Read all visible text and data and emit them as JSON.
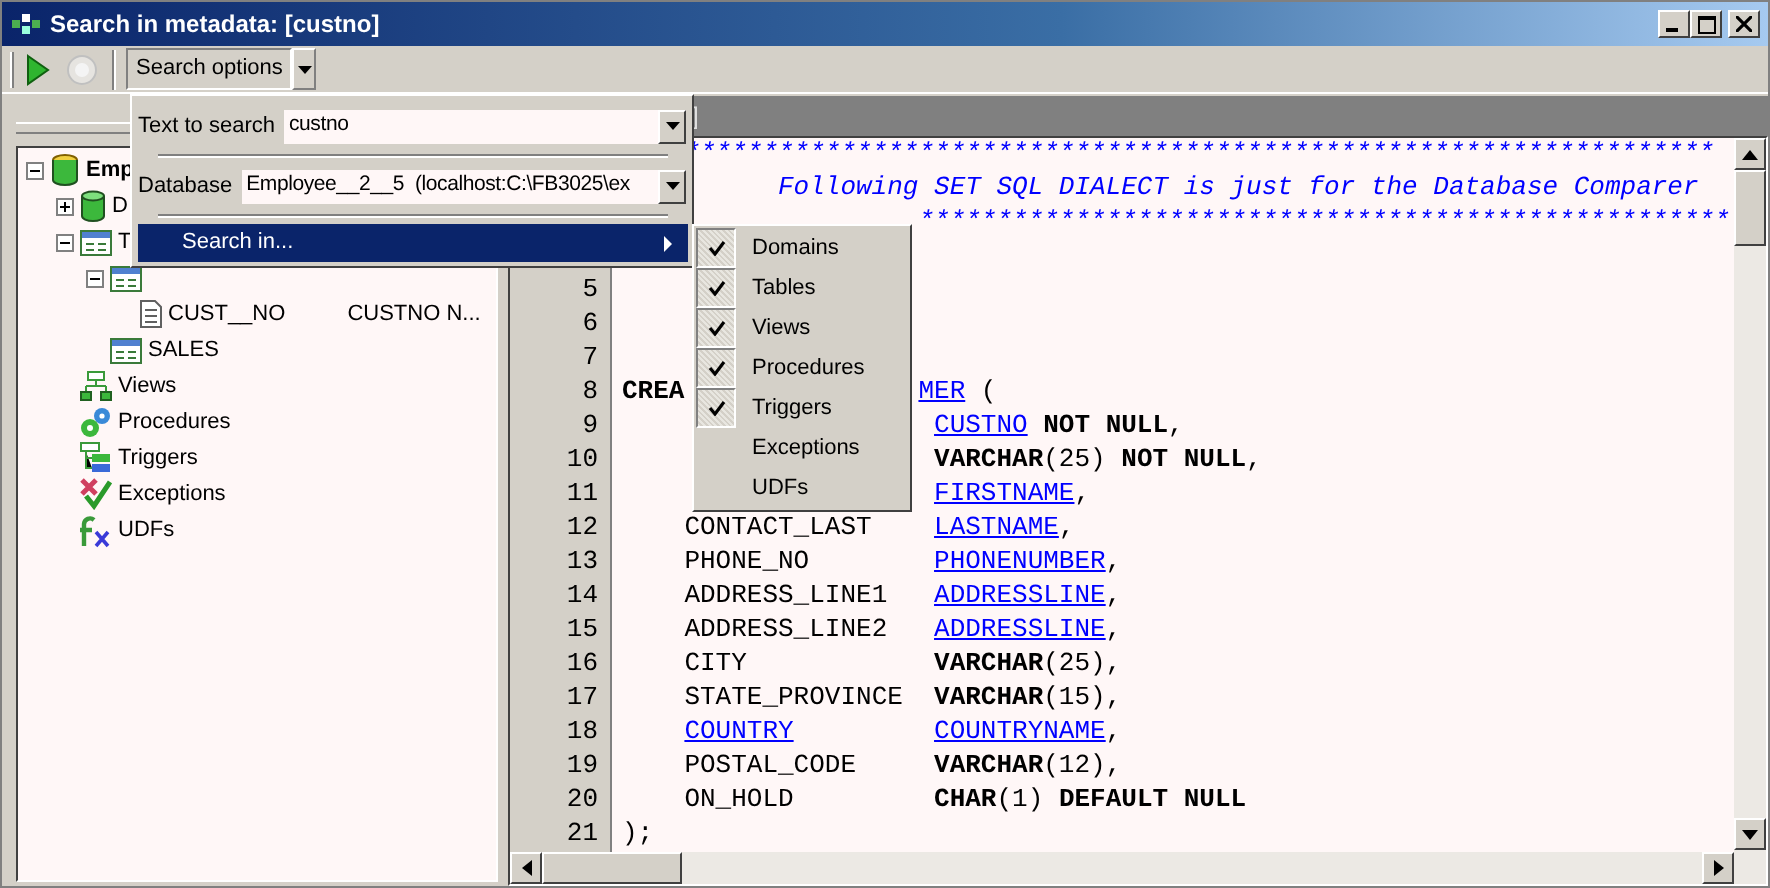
{
  "window": {
    "title": "Search in metadata: [custno]"
  },
  "toolbar": [
    {
      "kind": "run",
      "disabled": false
    },
    {
      "kind": "stop",
      "disabled": true
    }
  ],
  "search_options": {
    "label": "Search options",
    "pressed": true
  },
  "tree": [
    {
      "kind": "database",
      "label": "Emp",
      "expanded": true,
      "children": [
        {
          "kind": "domains",
          "label": "D",
          "expanded": false
        },
        {
          "kind": "tables",
          "label": "T",
          "expanded": true,
          "children": [
            {
              "kind": "table",
              "expanded": true,
              "children": [
                {
                  "kind": "field",
                  "label": "CUST__NO",
                  "detail": "CUSTNO N..."
                }
              ]
            },
            {
              "kind": "table",
              "label": "SALES"
            }
          ]
        },
        {
          "kind": "views",
          "label": "Views"
        },
        {
          "kind": "procedures",
          "label": "Procedures"
        },
        {
          "kind": "triggers",
          "label": "Triggers"
        },
        {
          "kind": "exceptions",
          "label": "Exceptions"
        },
        {
          "kind": "udfs",
          "label": "UDFs"
        }
      ]
    }
  ],
  "editor": {
    "tab": "]",
    "lines": [
      {
        "kind": "banner",
        "segs": [
          {
            "kind": "comment",
            "t": "******************************************************************"
          }
        ]
      },
      {
        "kind": "note",
        "segs": [
          {
            "kind": "comment",
            "t": "Following SET SQL DIALECT is just for the Database Comparer"
          }
        ]
      },
      {
        "kind": "banner_tail",
        "segs": [
          {
            "kind": "comment",
            "t": "****************************************************"
          }
        ]
      },
      {
        "kind": "blank"
      },
      {
        "kind": "blank",
        "no": "5"
      },
      {
        "kind": "blank",
        "no": "6"
      },
      {
        "kind": "blank",
        "no": "7"
      },
      {
        "kind": "stmt",
        "no": "8",
        "name": [
          {
            "kind": "kw",
            "t": "CREA"
          }
        ],
        "type": [
          {
            "kind": "link",
            "t": "MER"
          },
          {
            "kind": "plain",
            "t": " ("
          }
        ]
      },
      {
        "kind": "field",
        "no": "9",
        "type": [
          {
            "kind": "link",
            "t": "CUSTNO"
          },
          {
            "kind": "kw",
            "t": " NOT NULL"
          },
          {
            "kind": "plain",
            "t": ","
          }
        ]
      },
      {
        "kind": "field",
        "no": "10",
        "type": [
          {
            "kind": "kw",
            "t": "VARCHAR"
          },
          {
            "kind": "plain",
            "t": "(25) "
          },
          {
            "kind": "kw",
            "t": "NOT NULL"
          },
          {
            "kind": "plain",
            "t": ","
          }
        ]
      },
      {
        "kind": "field",
        "no": "11",
        "type": [
          {
            "kind": "link",
            "t": "FIRSTNAME"
          },
          {
            "kind": "plain",
            "t": ","
          }
        ]
      },
      {
        "kind": "field",
        "no": "12",
        "name": [
          {
            "kind": "plain",
            "t": "CONTACT_LAST"
          }
        ],
        "type": [
          {
            "kind": "link",
            "t": "LASTNAME"
          },
          {
            "kind": "plain",
            "t": ","
          }
        ]
      },
      {
        "kind": "field",
        "no": "13",
        "name": [
          {
            "kind": "plain",
            "t": "PHONE_NO"
          }
        ],
        "type": [
          {
            "kind": "link",
            "t": "PHONENUMBER"
          },
          {
            "kind": "plain",
            "t": ","
          }
        ]
      },
      {
        "kind": "field",
        "no": "14",
        "name": [
          {
            "kind": "plain",
            "t": "ADDRESS_LINE1"
          }
        ],
        "type": [
          {
            "kind": "link",
            "t": "ADDRESSLINE"
          },
          {
            "kind": "plain",
            "t": ","
          }
        ]
      },
      {
        "kind": "field",
        "no": "15",
        "name": [
          {
            "kind": "plain",
            "t": "ADDRESS_LINE2"
          }
        ],
        "type": [
          {
            "kind": "link",
            "t": "ADDRESSLINE"
          },
          {
            "kind": "plain",
            "t": ","
          }
        ]
      },
      {
        "kind": "field",
        "no": "16",
        "name": [
          {
            "kind": "plain",
            "t": "CITY"
          }
        ],
        "type": [
          {
            "kind": "kw",
            "t": "VARCHAR"
          },
          {
            "kind": "plain",
            "t": "(25),"
          }
        ]
      },
      {
        "kind": "field",
        "no": "17",
        "name": [
          {
            "kind": "plain",
            "t": "STATE_PROVINCE"
          }
        ],
        "type": [
          {
            "kind": "kw",
            "t": "VARCHAR"
          },
          {
            "kind": "plain",
            "t": "(15),"
          }
        ]
      },
      {
        "kind": "field",
        "no": "18",
        "name": [
          {
            "kind": "link",
            "t": "COUNTRY"
          }
        ],
        "type": [
          {
            "kind": "link",
            "t": "COUNTRYNAME"
          },
          {
            "kind": "plain",
            "t": ","
          }
        ]
      },
      {
        "kind": "field",
        "no": "19",
        "name": [
          {
            "kind": "plain",
            "t": "POSTAL_CODE"
          }
        ],
        "type": [
          {
            "kind": "kw",
            "t": "VARCHAR"
          },
          {
            "kind": "plain",
            "t": "(12),"
          }
        ]
      },
      {
        "kind": "field",
        "no": "20",
        "name": [
          {
            "kind": "plain",
            "t": "ON_HOLD"
          }
        ],
        "type": [
          {
            "kind": "kw",
            "t": "CHAR"
          },
          {
            "kind": "plain",
            "t": "(1) "
          },
          {
            "kind": "kw",
            "t": "DEFAULT NULL"
          }
        ]
      },
      {
        "kind": "stmt",
        "no": "21",
        "name": [
          {
            "kind": "plain",
            "t": ");"
          }
        ]
      }
    ]
  },
  "search_panel": {
    "text_label": "Text to search",
    "text_value": "custno",
    "db_label": "Database",
    "db_value": "Employee__2__5  (localhost:C:\\FB3025\\ex",
    "search_in": "Search in..."
  },
  "search_in_menu": [
    {
      "label": "Domains",
      "checked": true
    },
    {
      "label": "Tables",
      "checked": true
    },
    {
      "label": "Views",
      "checked": true
    },
    {
      "label": "Procedures",
      "checked": true
    },
    {
      "label": "Triggers",
      "checked": true
    },
    {
      "label": "Exceptions",
      "checked": false
    },
    {
      "label": "UDFs",
      "checked": false
    }
  ]
}
